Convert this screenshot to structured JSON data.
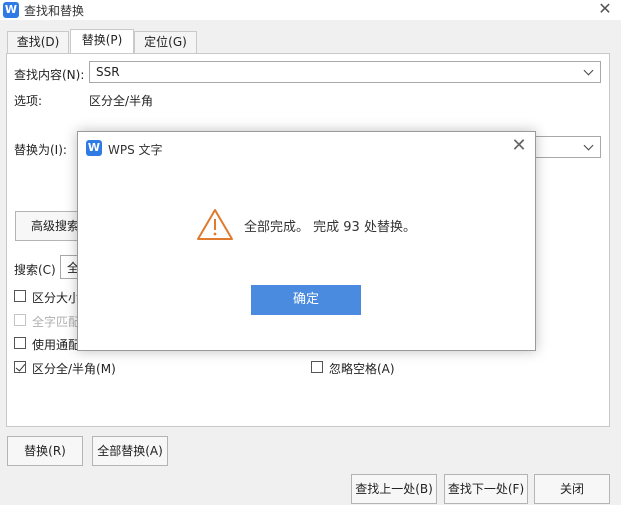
{
  "window": {
    "title": "查找和替换",
    "close_glyph": "✕"
  },
  "tabs": [
    {
      "label": "查找(D)",
      "active": false
    },
    {
      "label": "替换(P)",
      "active": true
    },
    {
      "label": "定位(G)",
      "active": false
    }
  ],
  "find": {
    "label": "查找内容(N):",
    "value": "SSR"
  },
  "options": {
    "label": "选项:",
    "value": "区分全/半角"
  },
  "replace": {
    "label": "替换为(I):",
    "value": ""
  },
  "advanced_button": "高级搜索",
  "search": {
    "label": "搜索(C)",
    "value_partial": "全"
  },
  "checkboxes": {
    "match_case": {
      "label": "区分大小",
      "checked": false
    },
    "whole_word": {
      "label": "全字匹配",
      "checked": false,
      "disabled": true
    },
    "wildcards": {
      "label": "使用通配",
      "checked": false
    },
    "full_half": {
      "label": "区分全/半角(M)",
      "checked": true
    },
    "ignore_space": {
      "label": "忽略空格(A)",
      "checked": false
    }
  },
  "buttons": {
    "replace": "替换(R)",
    "replace_all": "全部替换(A)",
    "find_prev": "查找上一处(B)",
    "find_next": "查找下一处(F)",
    "close": "关闭"
  },
  "modal": {
    "title": "WPS 文字",
    "message": "全部完成。 完成 93 处替换。",
    "ok_label": "确定",
    "close_glyph": "✕"
  },
  "icons": {
    "app": "wps-writer-icon",
    "warning": "warning-triangle-icon"
  },
  "colors": {
    "accent": "#4a8bdf",
    "app_icon": "#2f7be5",
    "warning": "#e07a2e"
  }
}
